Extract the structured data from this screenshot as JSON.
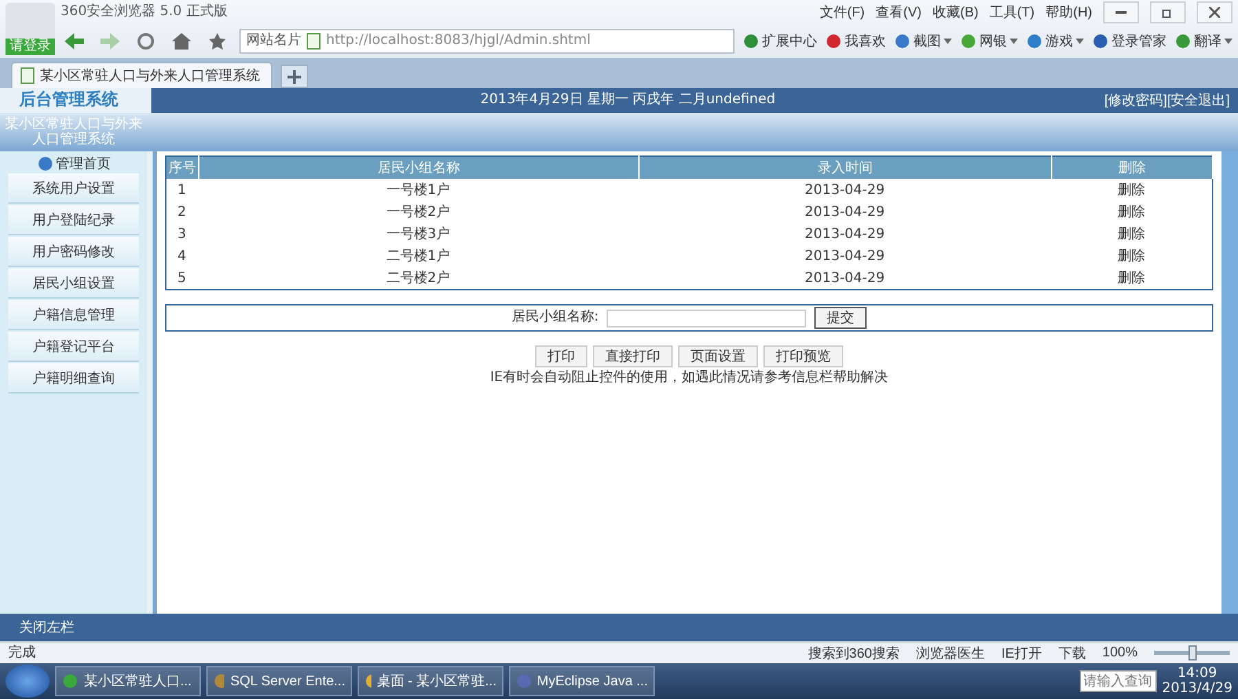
{
  "browser": {
    "title": "360安全浏览器 5.0 正式版",
    "login_label": "请登录",
    "menu": [
      "文件(F)",
      "查看(V)",
      "收藏(B)",
      "工具(T)",
      "帮助(H)"
    ],
    "address_label": "网站名片",
    "url": "http://localhost:8083/hjgl/Admin.shtml",
    "toolbar": [
      {
        "label": "扩展中心",
        "dropdown": false
      },
      {
        "label": "我喜欢",
        "dropdown": false
      },
      {
        "label": "截图",
        "dropdown": true
      },
      {
        "label": "网银",
        "dropdown": true
      },
      {
        "label": "游戏",
        "dropdown": true
      },
      {
        "label": "登录管家",
        "dropdown": false
      },
      {
        "label": "翻译",
        "dropdown": true
      }
    ],
    "tab": {
      "title": "某小区常驻人口与外来人口管理系统"
    }
  },
  "app": {
    "title": "后台管理系统",
    "date": "2013年4月29日 星期一 丙戌年 二月undefined",
    "links": [
      "[修改密码]",
      "[安全退出]"
    ],
    "sidebar": {
      "heading_lines": [
        "某小区常驻人口与外来",
        "人口管理系统"
      ],
      "home": "管理首页",
      "items": [
        "系统用户设置",
        "用户登陆纪录",
        "用户密码修改",
        "居民小组设置",
        "户籍信息管理",
        "户籍登记平台",
        "户籍明细查询"
      ]
    },
    "table": {
      "columns": [
        "序号",
        "居民小组名称",
        "录入时间",
        "删除"
      ],
      "rows": [
        [
          "1",
          "一号楼1户",
          "2013-04-29",
          "删除"
        ],
        [
          "2",
          "一号楼2户",
          "2013-04-29",
          "删除"
        ],
        [
          "3",
          "一号楼3户",
          "2013-04-29",
          "删除"
        ],
        [
          "4",
          "二号楼1户",
          "2013-04-29",
          "删除"
        ],
        [
          "5",
          "二号楼2户",
          "2013-04-29",
          "删除"
        ]
      ]
    },
    "form": {
      "label": "居民小组名称:",
      "button": "提交"
    },
    "print_buttons": [
      "打印",
      "直接打印",
      "页面设置",
      "打印预览"
    ],
    "note": "IE有时会自动阻止控件的使用，如遇此情况请参考信息栏帮助解决",
    "footer": "关闭左栏"
  },
  "status_bar": {
    "text": "完成",
    "items": [
      "搜索到360搜索",
      "浏览器医生",
      "IE打开",
      "下载"
    ],
    "zoom": "100%",
    "zoom_slider": {
      "level": 0.5
    }
  },
  "taskbar": {
    "items": [
      {
        "label": "某小区常驻人口..."
      },
      {
        "label": "SQL Server Ente..."
      },
      {
        "label": "桌面 - 某小区常驻..."
      },
      {
        "label": "MyEclipse Java ..."
      }
    ],
    "search_placeholder": "请输入查询",
    "time": "14:09",
    "date": "2013/4/29"
  }
}
